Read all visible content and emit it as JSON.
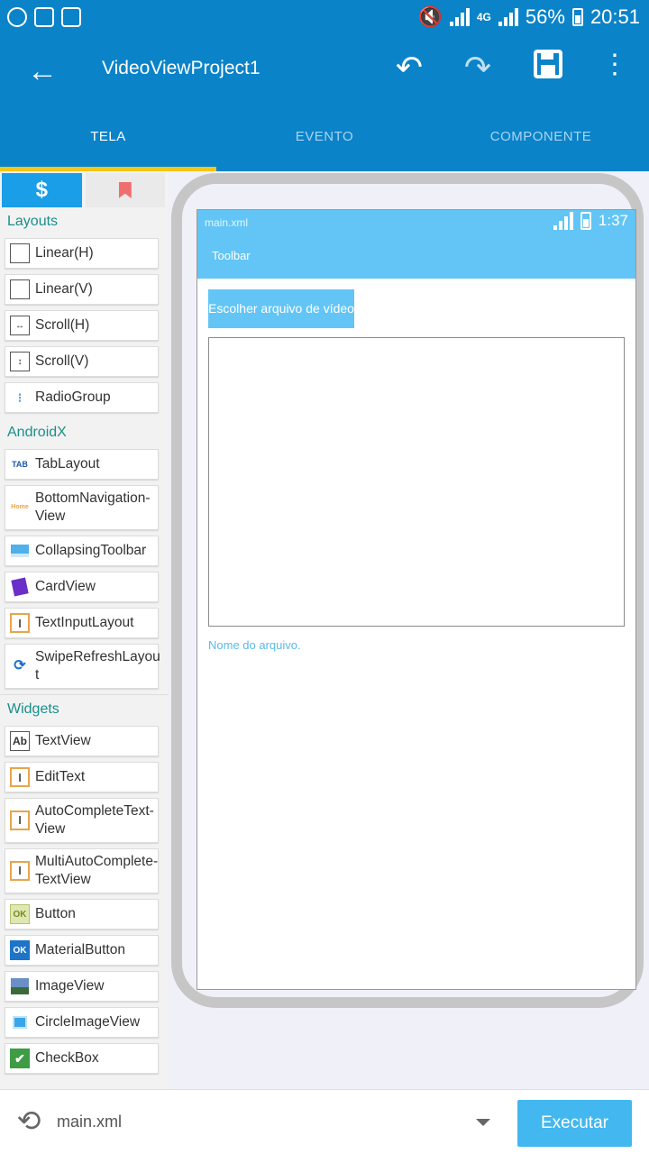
{
  "status_bar": {
    "battery": "56%",
    "time": "20:51",
    "network": "4G"
  },
  "app_bar": {
    "title": "VideoViewProject1",
    "icons": [
      "back-arrow-icon",
      "undo-icon",
      "redo-icon",
      "save-icon",
      "more-vert-icon"
    ]
  },
  "tabs": [
    {
      "label": "TELA"
    },
    {
      "label": "EVENTO"
    },
    {
      "label": "COMPONENTE"
    }
  ],
  "palette": {
    "sections": [
      {
        "title": "Layouts",
        "items": [
          "Linear(H)",
          "Linear(V)",
          "Scroll(H)",
          "Scroll(V)",
          "RadioGroup"
        ]
      },
      {
        "title": "AndroidX",
        "items": [
          "TabLayout",
          "BottomNavigation-View",
          "CollapsingToolbar",
          "CardView",
          "TextInputLayout",
          "SwipeRefreshLayout"
        ]
      },
      {
        "title": "Widgets",
        "items": [
          "TextView",
          "EditText",
          "AutoCompleteText-View",
          "MultiAutoComplete-TextView",
          "Button",
          "MaterialButton",
          "ImageView",
          "CircleImageView",
          "CheckBox"
        ]
      }
    ],
    "wrapped": {
      "bn1": "BottomNavigation-",
      "bn2": "View",
      "sr1": "SwipeRefreshLayou",
      "sr2": "t",
      "ac1": "AutoCompleteText-",
      "ac2": "View",
      "mac1": "MultiAutoComplete-",
      "mac2": "TextView"
    },
    "icon_text": {
      "tab": "TAB",
      "home": "Home",
      "ab": "Ab",
      "ok": "OK"
    }
  },
  "preview": {
    "file": "main.xml",
    "time": "1:37",
    "toolbar": "Toolbar",
    "button": "Escolher arquivo de vídeo",
    "text": "Nome do arquivo."
  },
  "bottom_bar": {
    "file": "main.xml",
    "run_label": "Executar"
  },
  "colors": {
    "primary": "#0a83c9",
    "accent": "#f5c518",
    "preview": "#62c5f5",
    "section": "#1a8f8a"
  }
}
